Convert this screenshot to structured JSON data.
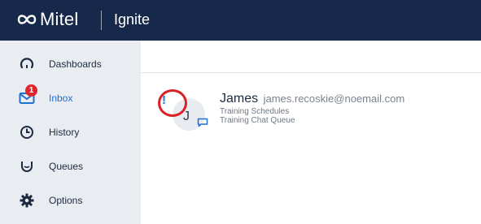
{
  "header": {
    "brand": "Mitel",
    "product": "Ignite"
  },
  "sidebar": {
    "items": [
      {
        "label": "Dashboards",
        "icon": "gauge-icon",
        "active": false
      },
      {
        "label": "Inbox",
        "icon": "envelope-icon",
        "active": true,
        "badge": "1"
      },
      {
        "label": "History",
        "icon": "clock-icon",
        "active": false
      },
      {
        "label": "Queues",
        "icon": "queue-cup-icon",
        "active": false
      },
      {
        "label": "Options",
        "icon": "gear-icon",
        "active": false
      }
    ]
  },
  "inbox": {
    "items": [
      {
        "alert": "!",
        "avatar_letter": "J",
        "name": "James",
        "email": "james.recoskie@noemail.com",
        "line1": "Training Schedules",
        "line2": "Training Chat Queue",
        "channel_icon": "chat-icon"
      }
    ]
  },
  "colors": {
    "header_bg": "#16294a",
    "sidebar_bg": "#e9ecf1",
    "accent": "#1f6fd1",
    "badge": "#e0262c",
    "highlight_circle": "#d82226"
  }
}
